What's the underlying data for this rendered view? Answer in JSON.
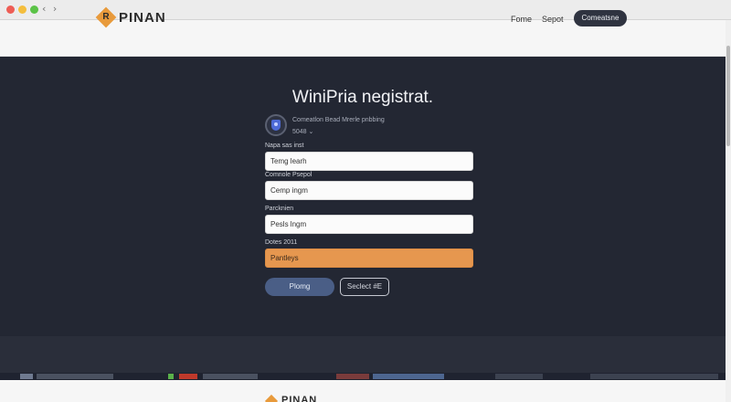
{
  "window": {
    "nav_arrows": "‹ ›"
  },
  "header": {
    "logo_letter": "R",
    "brand": "PINAN",
    "nav": {
      "home": "Fome",
      "support": "Sepot",
      "cta": "Comeatsne"
    }
  },
  "form": {
    "title": "WiniPria negistrat.",
    "info_line": "Comeatlon Bead Mrerle pnbbing",
    "info_sub": "5048 ⌄",
    "fields": [
      {
        "label": "Napa sas inst",
        "value": "Temg learh"
      },
      {
        "label": "Comnole Psepol",
        "value": "Cemp ingm"
      },
      {
        "label": "Parcknien",
        "value": "Pesls lngm"
      },
      {
        "label": "Dotes 2011",
        "value": "Pantleys"
      }
    ],
    "primary_button": "Plomg",
    "secondary_button": "Seclect #E"
  },
  "footer": {
    "brand": "PINAN"
  },
  "colors": {
    "accent": "#e89a3b",
    "hero_bg": "#232733",
    "primary_button": "#4a5e86",
    "orange_field": "#e6974f"
  }
}
